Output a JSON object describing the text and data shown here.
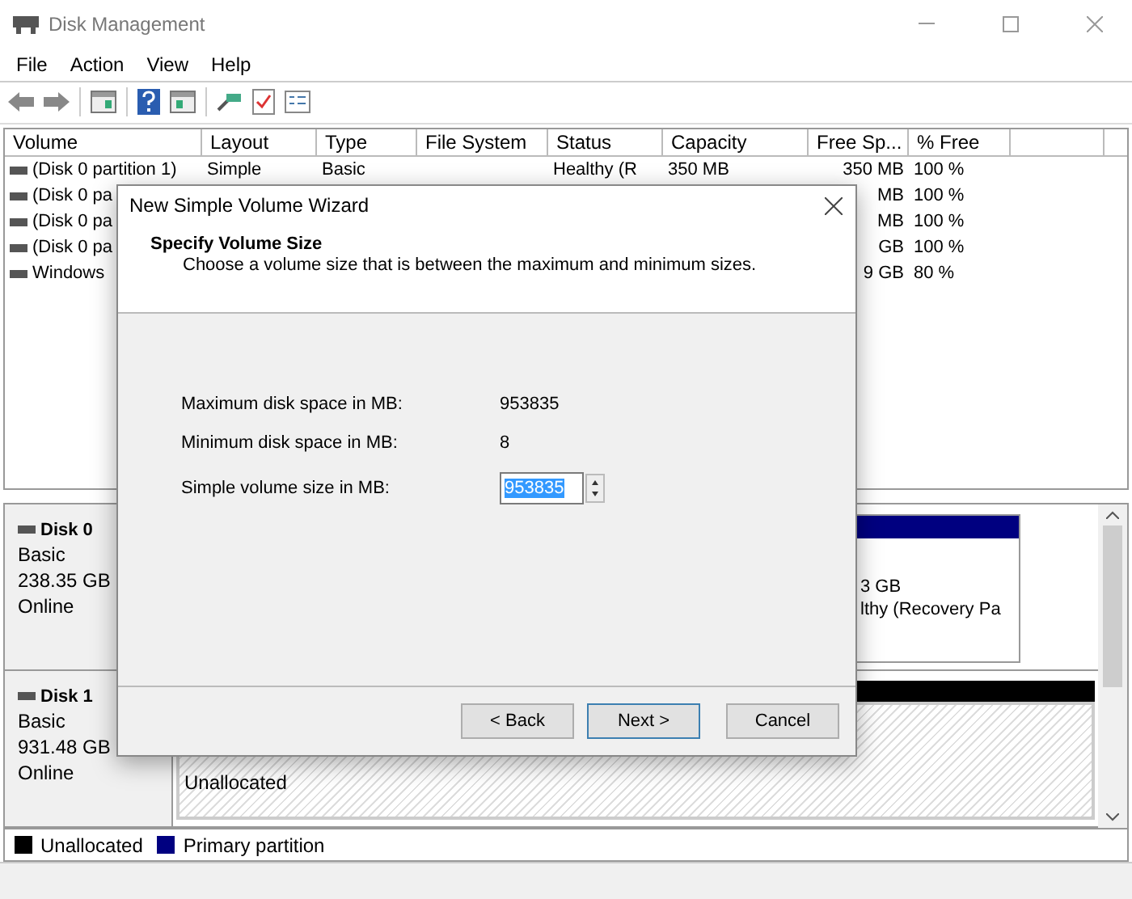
{
  "window": {
    "title": "Disk Management"
  },
  "menu": [
    "File",
    "Action",
    "View",
    "Help"
  ],
  "table": {
    "columns": [
      "Volume",
      "Layout",
      "Type",
      "File System",
      "Status",
      "Capacity",
      "Free Sp...",
      "% Free"
    ],
    "rows": [
      {
        "volume": "(Disk 0 partition 1)",
        "layout": "Simple",
        "type": "Basic",
        "status": "Healthy (R",
        "capacity": "350 MB",
        "free_space": "350 MB",
        "percent_free": "100 %"
      },
      {
        "volume": "(Disk 0 pa",
        "free_space": "MB",
        "percent_free": "100 %"
      },
      {
        "volume": "(Disk 0 pa",
        "free_space": "MB",
        "percent_free": "100 %"
      },
      {
        "volume": "(Disk 0 pa",
        "free_space": "GB",
        "percent_free": "100 %"
      },
      {
        "volume": "Windows",
        "free_space": "9 GB",
        "percent_free": "80 %"
      }
    ]
  },
  "disks": [
    {
      "name": "Disk 0",
      "lines": [
        "Basic",
        "238.35 GB",
        "Online"
      ],
      "kind": "partitioned",
      "partition_lines": [
        "3 GB",
        "lthy (Recovery Pa"
      ]
    },
    {
      "name": "Disk 1",
      "lines": [
        "Basic",
        "931.48 GB",
        "Online"
      ],
      "kind": "unallocated",
      "region_label": "Unallocated"
    }
  ],
  "legend": [
    {
      "label": "Unallocated",
      "color": "#000000"
    },
    {
      "label": "Primary partition",
      "color": "#000080"
    }
  ],
  "dialog": {
    "title": "New Simple Volume Wizard",
    "heading": "Specify Volume Size",
    "subtitle": "Choose a volume size that is between the maximum and minimum sizes.",
    "fields": [
      {
        "label": "Maximum disk space in MB:",
        "value": "953835",
        "kind": "text"
      },
      {
        "label": "Minimum disk space in MB:",
        "value": "8",
        "kind": "text"
      },
      {
        "label": "Simple volume size in MB:",
        "value": "953835",
        "kind": "spin"
      }
    ],
    "buttons": [
      {
        "label": "< Back",
        "default": false
      },
      {
        "label": "Next >",
        "default": true
      },
      {
        "label": "Cancel",
        "default": false
      }
    ]
  }
}
